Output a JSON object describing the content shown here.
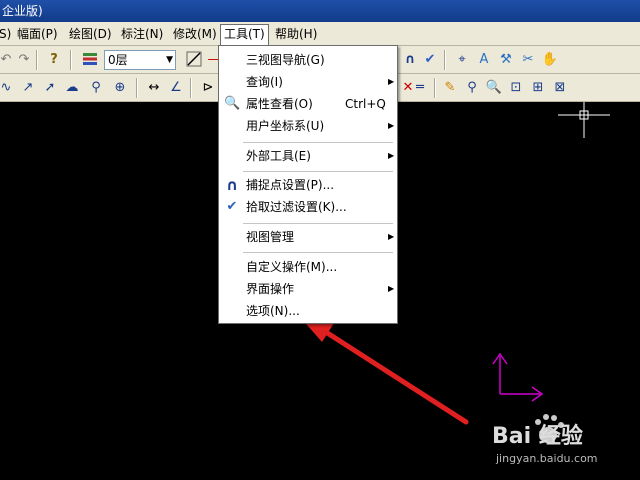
{
  "window": {
    "title": "企业版)"
  },
  "menubar": {
    "items": [
      {
        "label": "S)"
      },
      {
        "label": "幅面(P)"
      },
      {
        "label": "绘图(D)"
      },
      {
        "label": "标注(N)"
      },
      {
        "label": "修改(M)"
      },
      {
        "label": "工具(T)"
      },
      {
        "label": "帮助(H)"
      }
    ]
  },
  "toolbar": {
    "layer_value": "0层"
  },
  "tools_menu": {
    "items": [
      {
        "label": "三视图导航(G)"
      },
      {
        "label": "查询(I)"
      },
      {
        "label": "属性查看(O)",
        "shortcut": "Ctrl+Q"
      },
      {
        "label": "用户坐标系(U)"
      },
      {
        "label": "外部工具(E)"
      },
      {
        "label": "捕捉点设置(P)..."
      },
      {
        "label": "拾取过滤设置(K)..."
      },
      {
        "label": "视图管理"
      },
      {
        "label": "自定义操作(M)..."
      },
      {
        "label": "界面操作"
      },
      {
        "label": "选项(N)..."
      }
    ]
  },
  "colors": {
    "annotation_arrow": "#e02020",
    "ucs_icon": "#d000d0",
    "cursor": "#ffffff",
    "menubar_bg": "#ece9d8",
    "titlebar_bg": "#1f4fa8"
  },
  "watermark": {
    "brand": "Bai 经验",
    "url": "jingyan.baidu.com"
  }
}
